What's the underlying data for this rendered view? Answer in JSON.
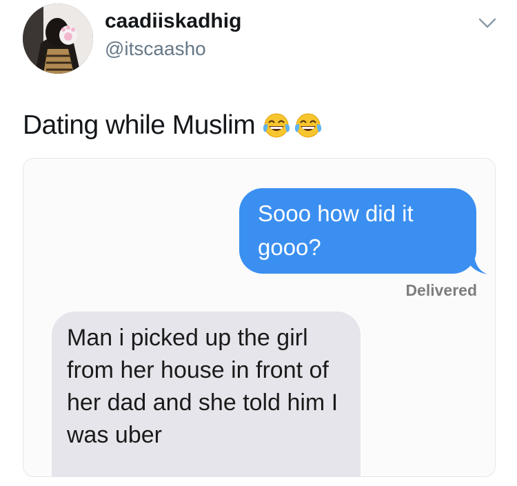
{
  "tweet": {
    "display_name": "caadiiskadhig",
    "handle": "@itscaasho",
    "text": "Dating while Muslim",
    "emojis": [
      "face-with-tears-of-joy-icon",
      "face-with-tears-of-joy-icon"
    ]
  },
  "media": {
    "outgoing_message": "Sooo how did it gooo?",
    "status": "Delivered",
    "incoming_message": "Man i picked up the girl from her house in front of her dad and she told him I was uber"
  },
  "colors": {
    "outgoing_bubble": "#3b8ff0",
    "incoming_bubble": "#e6e5eb",
    "handle_gray": "#657786"
  }
}
